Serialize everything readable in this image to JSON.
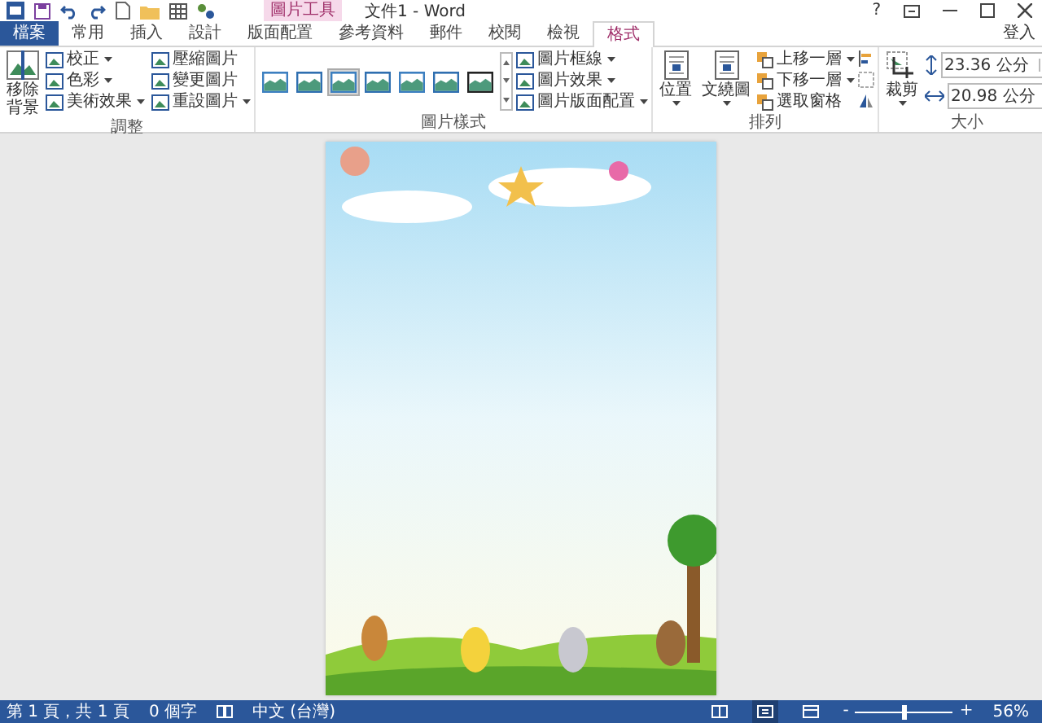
{
  "title_bar": {
    "title": "文件1 - Word",
    "tool_context": "圖片工具",
    "help": "?",
    "sign_in": "登入"
  },
  "tabs": [
    {
      "label": "檔案",
      "kind": "file",
      "selected": false
    },
    {
      "label": "常用",
      "kind": "normal",
      "selected": false
    },
    {
      "label": "插入",
      "kind": "normal",
      "selected": false
    },
    {
      "label": "設計",
      "kind": "normal",
      "selected": false
    },
    {
      "label": "版面配置",
      "kind": "normal",
      "selected": false
    },
    {
      "label": "參考資料",
      "kind": "normal",
      "selected": false
    },
    {
      "label": "郵件",
      "kind": "normal",
      "selected": false
    },
    {
      "label": "校閱",
      "kind": "normal",
      "selected": false
    },
    {
      "label": "檢視",
      "kind": "normal",
      "selected": false
    },
    {
      "label": "格式",
      "kind": "context",
      "selected": true
    }
  ],
  "adjust": {
    "label": "調整",
    "remove_bg": "移除背景",
    "buttons": [
      {
        "label": "校正",
        "dropdown": true
      },
      {
        "label": "色彩",
        "dropdown": true
      },
      {
        "label": "美術效果",
        "dropdown": true
      },
      {
        "label": "壓縮圖片",
        "dropdown": false
      },
      {
        "label": "變更圖片",
        "dropdown": false
      },
      {
        "label": "重設圖片",
        "dropdown": true
      }
    ]
  },
  "styles": {
    "label": "圖片樣式",
    "gallery": [
      {
        "selected": false
      },
      {
        "selected": false
      },
      {
        "selected": true
      },
      {
        "selected": false
      },
      {
        "selected": false
      },
      {
        "selected": false
      },
      {
        "selected": false
      }
    ],
    "buttons": [
      {
        "label": "圖片框線",
        "dropdown": true
      },
      {
        "label": "圖片效果",
        "dropdown": true
      },
      {
        "label": "圖片版面配置",
        "dropdown": true
      }
    ]
  },
  "arrange": {
    "label": "排列",
    "big": [
      {
        "label": "位置",
        "dropdown": true
      },
      {
        "label": "文繞圖",
        "dropdown": true
      }
    ],
    "buttons": [
      {
        "label": "上移一層",
        "dropdown": true
      },
      {
        "label": "下移一層",
        "dropdown": true
      },
      {
        "label": "選取窗格",
        "dropdown": false
      }
    ]
  },
  "size": {
    "label": "大小",
    "crop": {
      "label": "裁剪",
      "dropdown": true
    },
    "height": "23.36 公分",
    "width": "20.98 公分"
  },
  "status_bar": {
    "page": "第 1 頁，共 1 頁",
    "words": "0 個字",
    "language": "中文 (台灣)",
    "views": [
      {
        "selected": false
      },
      {
        "selected": true
      },
      {
        "selected": false
      }
    ],
    "zoom_out": "-",
    "zoom_in": "+",
    "zoom_slider": {
      "level": 0.5
    },
    "zoom": "56%"
  }
}
